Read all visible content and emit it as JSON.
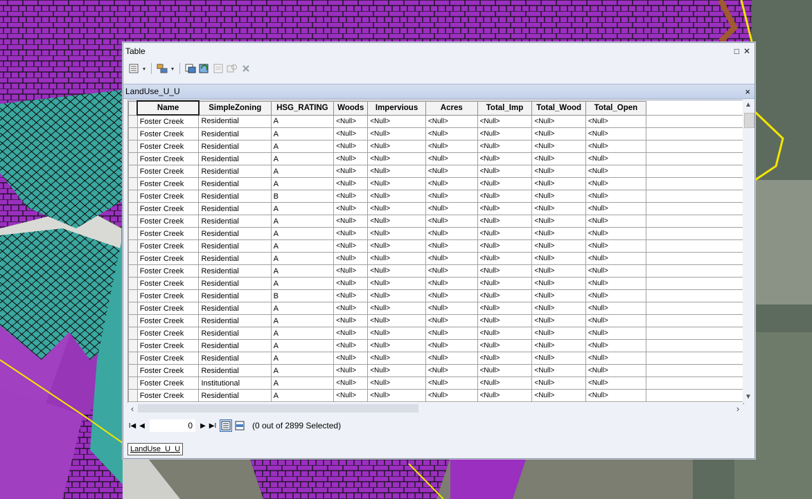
{
  "window": {
    "title": "Table",
    "restore_symbol": "□",
    "close_symbol": "✕"
  },
  "toolbar": {
    "table_options_icon": "table-options-icon",
    "related_tables_icon": "related-tables-icon",
    "select_by_attributes_icon": "select-by-attributes-icon",
    "switch_selection_icon": "switch-selection-icon",
    "clear_selection_icon": "clear-selection-icon",
    "zoom_to_selected_icon": "zoom-to-selected-icon",
    "delete_selected_icon": "delete-selected-icon"
  },
  "tab": {
    "name": "LandUse_U_U",
    "close_symbol": "×"
  },
  "grid": {
    "columns": [
      "Name",
      "SimpleZoning",
      "HSG_RATING",
      "Woods",
      "Impervious",
      "Acres",
      "Total_Imp",
      "Total_Wood",
      "Total_Open"
    ],
    "rows": [
      [
        "Foster Creek",
        "Residential",
        "A",
        "<Null>",
        "<Null>",
        "<Null>",
        "<Null>",
        "<Null>",
        "<Null>"
      ],
      [
        "Foster Creek",
        "Residential",
        "A",
        "<Null>",
        "<Null>",
        "<Null>",
        "<Null>",
        "<Null>",
        "<Null>"
      ],
      [
        "Foster Creek",
        "Residential",
        "A",
        "<Null>",
        "<Null>",
        "<Null>",
        "<Null>",
        "<Null>",
        "<Null>"
      ],
      [
        "Foster Creek",
        "Residential",
        "A",
        "<Null>",
        "<Null>",
        "<Null>",
        "<Null>",
        "<Null>",
        "<Null>"
      ],
      [
        "Foster Creek",
        "Residential",
        "A",
        "<Null>",
        "<Null>",
        "<Null>",
        "<Null>",
        "<Null>",
        "<Null>"
      ],
      [
        "Foster Creek",
        "Residential",
        "A",
        "<Null>",
        "<Null>",
        "<Null>",
        "<Null>",
        "<Null>",
        "<Null>"
      ],
      [
        "Foster Creek",
        "Residential",
        "B",
        "<Null>",
        "<Null>",
        "<Null>",
        "<Null>",
        "<Null>",
        "<Null>"
      ],
      [
        "Foster Creek",
        "Residential",
        "A",
        "<Null>",
        "<Null>",
        "<Null>",
        "<Null>",
        "<Null>",
        "<Null>"
      ],
      [
        "Foster Creek",
        "Residential",
        "A",
        "<Null>",
        "<Null>",
        "<Null>",
        "<Null>",
        "<Null>",
        "<Null>"
      ],
      [
        "Foster Creek",
        "Residential",
        "A",
        "<Null>",
        "<Null>",
        "<Null>",
        "<Null>",
        "<Null>",
        "<Null>"
      ],
      [
        "Foster Creek",
        "Residential",
        "A",
        "<Null>",
        "<Null>",
        "<Null>",
        "<Null>",
        "<Null>",
        "<Null>"
      ],
      [
        "Foster Creek",
        "Residential",
        "A",
        "<Null>",
        "<Null>",
        "<Null>",
        "<Null>",
        "<Null>",
        "<Null>"
      ],
      [
        "Foster Creek",
        "Residential",
        "A",
        "<Null>",
        "<Null>",
        "<Null>",
        "<Null>",
        "<Null>",
        "<Null>"
      ],
      [
        "Foster Creek",
        "Residential",
        "A",
        "<Null>",
        "<Null>",
        "<Null>",
        "<Null>",
        "<Null>",
        "<Null>"
      ],
      [
        "Foster Creek",
        "Residential",
        "B",
        "<Null>",
        "<Null>",
        "<Null>",
        "<Null>",
        "<Null>",
        "<Null>"
      ],
      [
        "Foster Creek",
        "Residential",
        "A",
        "<Null>",
        "<Null>",
        "<Null>",
        "<Null>",
        "<Null>",
        "<Null>"
      ],
      [
        "Foster Creek",
        "Residential",
        "A",
        "<Null>",
        "<Null>",
        "<Null>",
        "<Null>",
        "<Null>",
        "<Null>"
      ],
      [
        "Foster Creek",
        "Residential",
        "A",
        "<Null>",
        "<Null>",
        "<Null>",
        "<Null>",
        "<Null>",
        "<Null>"
      ],
      [
        "Foster Creek",
        "Residential",
        "A",
        "<Null>",
        "<Null>",
        "<Null>",
        "<Null>",
        "<Null>",
        "<Null>"
      ],
      [
        "Foster Creek",
        "Residential",
        "A",
        "<Null>",
        "<Null>",
        "<Null>",
        "<Null>",
        "<Null>",
        "<Null>"
      ],
      [
        "Foster Creek",
        "Residential",
        "A",
        "<Null>",
        "<Null>",
        "<Null>",
        "<Null>",
        "<Null>",
        "<Null>"
      ],
      [
        "Foster Creek",
        "Institutional",
        "A",
        "<Null>",
        "<Null>",
        "<Null>",
        "<Null>",
        "<Null>",
        "<Null>"
      ],
      [
        "Foster Creek",
        "Residential",
        "A",
        "<Null>",
        "<Null>",
        "<Null>",
        "<Null>",
        "<Null>",
        "<Null>"
      ]
    ]
  },
  "navigation": {
    "first_symbol": "I◀",
    "prev_symbol": "◀",
    "current_record": "0",
    "next_symbol": "▶",
    "last_symbol": "▶I",
    "selection_status": "(0 out of 2899 Selected)"
  },
  "bottom_tab": {
    "name": "LandUse_U_U"
  },
  "colors": {
    "map_zoning": "#9b2fc0",
    "map_water": "#3aa8a0",
    "map_boundary": "#f2e600",
    "window_bg": "#eef1f7",
    "header_bg": "#c3d1ea"
  }
}
